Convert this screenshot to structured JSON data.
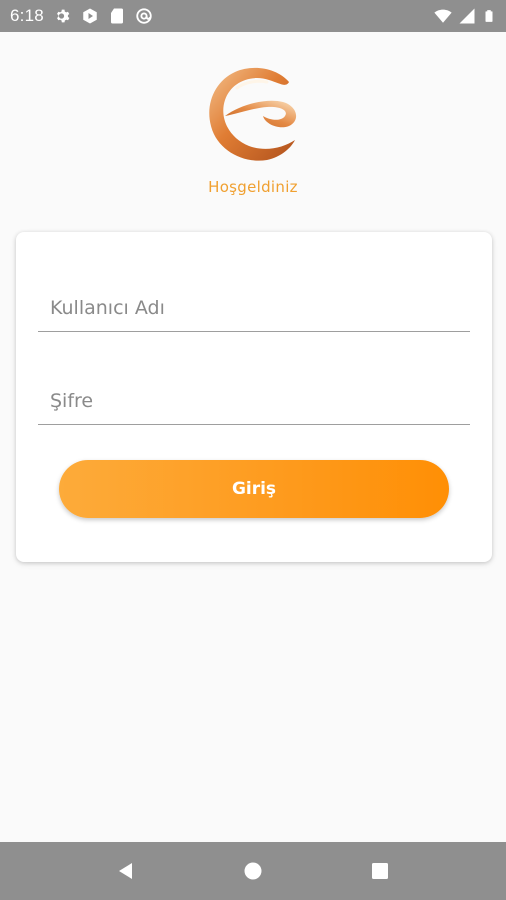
{
  "status_bar": {
    "time": "6:18",
    "left_icons": [
      "gear-icon",
      "play-icon",
      "sd-card-icon",
      "at-sign-icon"
    ],
    "right_icons": [
      "wifi-icon",
      "signal-icon",
      "battery-icon"
    ]
  },
  "header": {
    "logo_icon": "e-swirl-logo",
    "welcome_text": "Hoşgeldiniz"
  },
  "login_form": {
    "username_placeholder": "Kullanıcı Adı",
    "username_value": "",
    "password_placeholder": "Şifre",
    "password_value": "",
    "login_button_label": "Giriş"
  },
  "nav_bar": {
    "buttons": [
      "back-icon",
      "home-icon",
      "recents-icon"
    ]
  },
  "colors": {
    "accent": "#fe9a1c",
    "welcome_text": "#f0a030",
    "system_bars": "#8f8f8f",
    "background": "#fafafa"
  }
}
